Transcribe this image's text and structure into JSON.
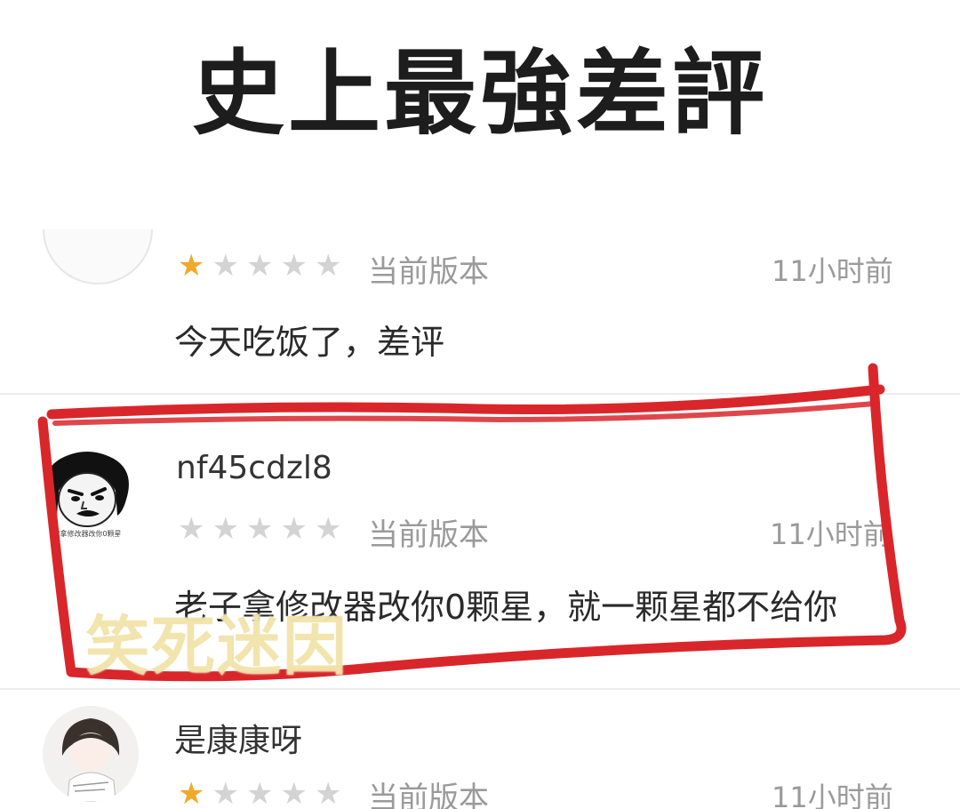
{
  "headline": "史上最強差評",
  "reviews": [
    {
      "rating": 1,
      "version_label": "当前版本",
      "time": "11小时前",
      "comment": "今天吃饭了，差评"
    },
    {
      "username": "nf45cdzl8",
      "avatar_caption": "我拿修改器改你0颗星",
      "rating": 0,
      "version_label": "当前版本",
      "time": "11小时前",
      "comment": "老子拿修改器改你0颗星，就一颗星都不给你"
    },
    {
      "username": "是康康呀",
      "rating": 1,
      "version_label": "当前版本",
      "time": "11小时前"
    }
  ],
  "watermark": "笑死迷因",
  "colors": {
    "highlight_stroke": "#d9262b",
    "star_filled": "#f0a92a",
    "star_empty": "#d3d3d3"
  }
}
